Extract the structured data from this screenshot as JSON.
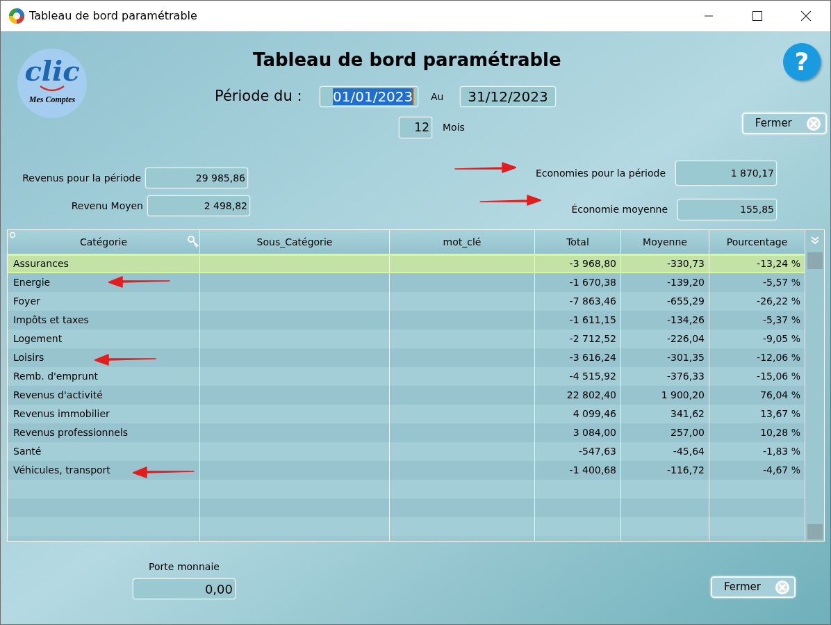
{
  "window": {
    "title": "Tableau de bord paramétrable"
  },
  "logo": {
    "text": "clic",
    "subtitle": "Mes Comptes"
  },
  "help": {
    "label": "?"
  },
  "header": {
    "title": "Tableau de bord paramétrable",
    "period_label": "Période du :",
    "date_from": {
      "value": "01/01/2023",
      "text_selected": true
    },
    "to_label": "Au",
    "date_to": "31/12/2023",
    "months": "12",
    "months_label": "Mois"
  },
  "close_button_top": {
    "label": "Fermer"
  },
  "summary_left": [
    {
      "label": "Revenus pour la période",
      "value": "29 985,86"
    },
    {
      "label": "Revenu Moyen",
      "value": "2 498,82"
    }
  ],
  "summary_right": [
    {
      "label": "Economies pour la période",
      "value": "1 870,17"
    },
    {
      "label": "Économie moyenne",
      "value": "155,85"
    }
  ],
  "table": {
    "columns": [
      "Catégorie",
      "Sous_Catégorie",
      "mot_clé",
      "Total",
      "Moyenne",
      "Pourcentage"
    ],
    "rows": [
      {
        "cells": [
          "Assurances",
          "",
          "",
          "-3 968,80",
          "-330,73",
          "-13,24 %"
        ],
        "selected": true
      },
      {
        "cells": [
          "Energie",
          "",
          "",
          "-1 670,38",
          "-139,20",
          "-5,57 %"
        ],
        "selected": false
      },
      {
        "cells": [
          "Foyer",
          "",
          "",
          "-7 863,46",
          "-655,29",
          "-26,22 %"
        ],
        "selected": false
      },
      {
        "cells": [
          "Impôts et taxes",
          "",
          "",
          "-1 611,15",
          "-134,26",
          "-5,37 %"
        ],
        "selected": false
      },
      {
        "cells": [
          "Logement",
          "",
          "",
          "-2 712,52",
          "-226,04",
          "-9,05 %"
        ],
        "selected": false
      },
      {
        "cells": [
          "Loisirs",
          "",
          "",
          "-3 616,24",
          "-301,35",
          "-12,06 %"
        ],
        "selected": false
      },
      {
        "cells": [
          "Remb. d'emprunt",
          "",
          "",
          "-4 515,92",
          "-376,33",
          "-15,06 %"
        ],
        "selected": false
      },
      {
        "cells": [
          "Revenus d'activité",
          "",
          "",
          "22 802,40",
          "1 900,20",
          "76,04 %"
        ],
        "selected": false
      },
      {
        "cells": [
          "Revenus immobilier",
          "",
          "",
          "4 099,46",
          "341,62",
          "13,67 %"
        ],
        "selected": false
      },
      {
        "cells": [
          "Revenus professionnels",
          "",
          "",
          "3 084,00",
          "257,00",
          "10,28 %"
        ],
        "selected": false
      },
      {
        "cells": [
          "Santé",
          "",
          "",
          "-547,63",
          "-45,64",
          "-1,83 %"
        ],
        "selected": false
      },
      {
        "cells": [
          "Véhicules, transport",
          "",
          "",
          "-1 400,68",
          "-116,72",
          "-4,67 %"
        ],
        "selected": false
      }
    ]
  },
  "footer": {
    "wallet_label": "Porte monnaie",
    "wallet_value": "0,00",
    "close_label": "Fermer"
  }
}
